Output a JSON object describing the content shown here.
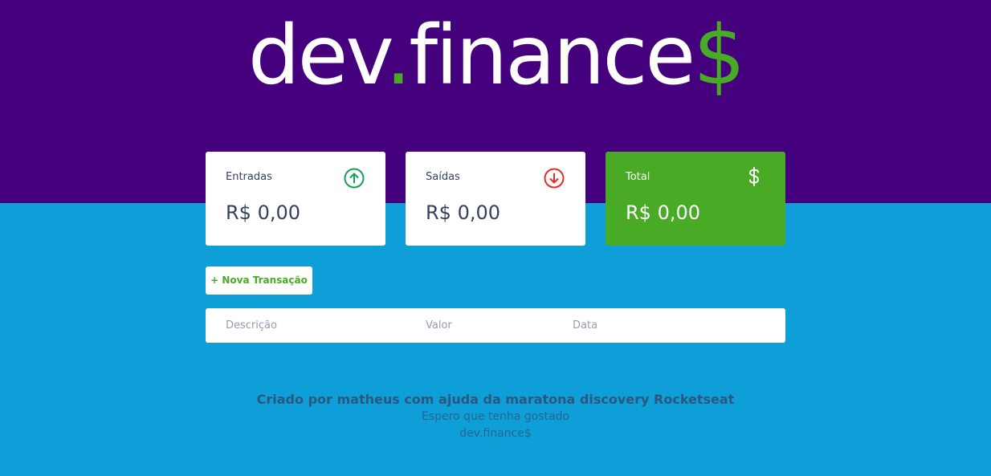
{
  "header": {
    "logo_text": "dev",
    "logo_dot": ".",
    "logo_text2": "finance",
    "logo_symbol": "$"
  },
  "balance": {
    "cards": [
      {
        "title": "Entradas",
        "value": "R$ 0,00",
        "icon": "arrow-up-circle-icon",
        "color": "#12a454"
      },
      {
        "title": "Saídas",
        "value": "R$ 0,00",
        "icon": "arrow-down-circle-icon",
        "color": "#e92929"
      },
      {
        "title": "Total",
        "value": "R$ 0,00",
        "icon": "dollar-sign-icon",
        "color": "#ffffff"
      }
    ]
  },
  "actions": {
    "new_transaction_label": "+ Nova Transação"
  },
  "table": {
    "headers": [
      "Descrição",
      "Valor",
      "Data"
    ]
  },
  "footer": {
    "credit": "Criado por matheus com ajuda da maratona discovery Rocketseat",
    "message": "Espero que tenha gostado",
    "brand": "dev.finance$"
  },
  "colors": {
    "header_bg": "#44007d",
    "body_bg": "#0e9fd8",
    "accent_green": "#49aa26",
    "text_dark": "#363f5f"
  }
}
